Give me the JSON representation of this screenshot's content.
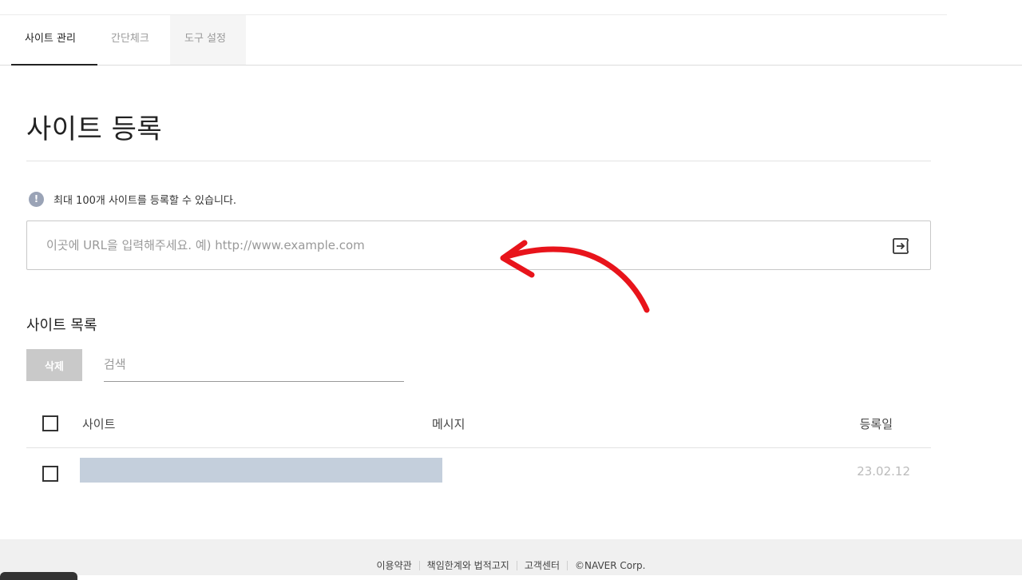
{
  "tabs": [
    {
      "label": "사이트 관리"
    },
    {
      "label": "간단체크"
    },
    {
      "label": "도구 설정"
    }
  ],
  "page": {
    "title": "사이트 등록",
    "notice": "최대 100개 사이트를 등록할 수 있습니다.",
    "notice_icon": "!"
  },
  "url_input": {
    "placeholder": "이곳에 URL을 입력해주세요. 예) http://www.example.com",
    "value": ""
  },
  "site_list": {
    "title": "사이트 목록",
    "delete_label": "삭제",
    "search_placeholder": "검색",
    "columns": {
      "site": "사이트",
      "message": "메시지",
      "date": "등록일"
    },
    "rows": [
      {
        "site": "",
        "message": "",
        "date": "23.02.12",
        "checked": false
      }
    ]
  },
  "footer": {
    "links": [
      "이용약관",
      "책임한계와 법적고지",
      "고객센터",
      "©NAVER Corp."
    ]
  },
  "colors": {
    "annotation_arrow": "#e8141b",
    "redacted_bar": "#c4cfdc",
    "notice_icon": "#9aa3b6"
  }
}
